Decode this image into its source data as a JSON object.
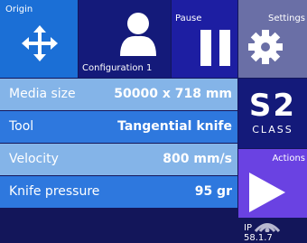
{
  "tiles": {
    "origin": "Origin",
    "configuration": "Configuration 1",
    "pause": "Pause",
    "settings": "Settings",
    "actions": "Actions"
  },
  "rows": [
    {
      "label": "Media size",
      "value": "50000 x 718 mm"
    },
    {
      "label": "Tool",
      "value": "Tangential knife"
    },
    {
      "label": "Velocity",
      "value": "800 mm/s"
    },
    {
      "label": "Knife pressure",
      "value": "95 gr"
    }
  ],
  "logo": {
    "top_text": "S2",
    "bottom_text": "CLASS"
  },
  "footer": {
    "ip_text": "IP",
    "ip_value": "58.1.7"
  },
  "icons": {
    "origin": "move-arrows-icon",
    "configuration": "user-icon",
    "pause": "pause-icon",
    "settings": "gear-icon",
    "actions": "play-icon",
    "footer": "wifi-icon"
  },
  "colors": {
    "background": "#13165a",
    "origin": "#1b6fd6",
    "configuration": "#141a7a",
    "pause": "#1d1ea2",
    "settings": "#6a6fa6",
    "row_light": "#84b4e8",
    "row_dark": "#2e78de",
    "actions": "#6a42e2"
  }
}
